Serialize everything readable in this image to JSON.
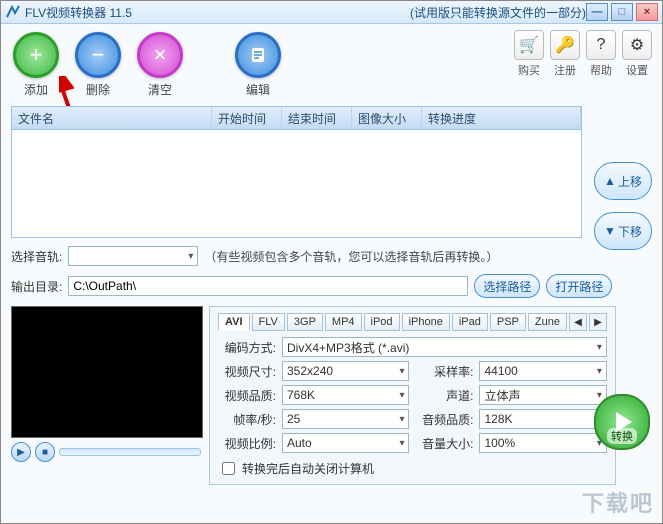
{
  "titlebar": {
    "app_name": "FLV视频转换器 11.5",
    "suffix": "(试用版只能转换源文件的一部分)"
  },
  "toolbar": {
    "add": "添加",
    "remove": "删除",
    "clear": "清空",
    "edit": "编辑",
    "buy": "购买",
    "register": "注册",
    "help": "帮助",
    "settings": "设置"
  },
  "columns": {
    "name": "文件名",
    "start": "开始时间",
    "end": "结束时间",
    "size": "图像大小",
    "progress": "转换进度"
  },
  "side": {
    "up": "上移",
    "down": "下移",
    "convert": "转换"
  },
  "audio": {
    "label": "选择音轨:",
    "value": "",
    "hint": "（有些视频包含多个音轨，您可以选择音轨后再转换。）"
  },
  "output": {
    "label": "输出目录:",
    "value": "C:\\OutPath\\",
    "choose": "选择路径",
    "open": "打开路径"
  },
  "formats": [
    "AVI",
    "FLV",
    "3GP",
    "MP4",
    "iPod",
    "iPhone",
    "iPad",
    "PSP",
    "Zune"
  ],
  "active_format": "AVI",
  "enc": {
    "codec_label": "编码方式:",
    "codec": "DivX4+MP3格式 (*.avi)",
    "size_label": "视频尺寸:",
    "size": "352x240",
    "samplerate_label": "采样率:",
    "samplerate": "44100",
    "vbitrate_label": "视频品质:",
    "vbitrate": "768K",
    "channels_label": "声道:",
    "channels": "立体声",
    "fps_label": "帧率/秒:",
    "fps": "25",
    "abitrate_label": "音频品质:",
    "abitrate": "128K",
    "ratio_label": "视频比例:",
    "ratio": "Auto",
    "volume_label": "音量大小:",
    "volume": "100%",
    "shutdown": "转换完后自动关闭计算机"
  },
  "watermark": "下载吧"
}
